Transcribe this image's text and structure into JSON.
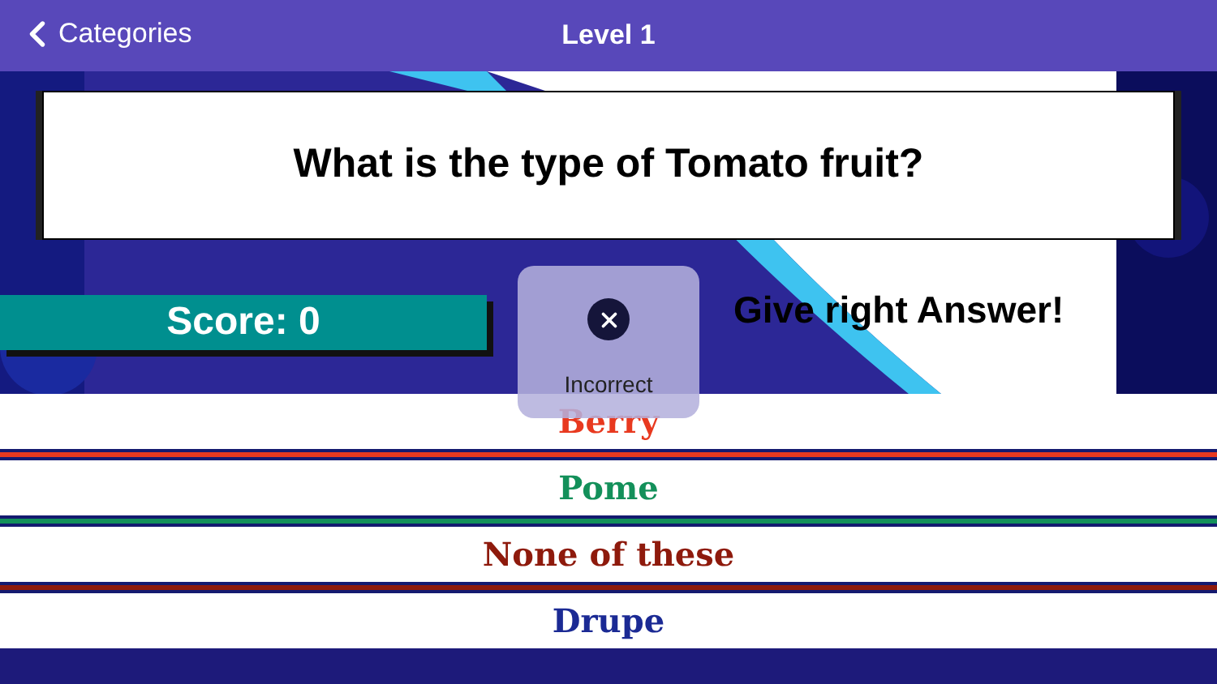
{
  "nav": {
    "back": "Categories",
    "title": "Level 1"
  },
  "question": "What is the type of Tomato fruit?",
  "score": "Score: 0",
  "prompt": "Give right Answer!",
  "hud": {
    "kind": "incorrect",
    "label": "Incorrect"
  },
  "answers": [
    {
      "text": "Berry",
      "color": "#e8391f"
    },
    {
      "text": "Pome",
      "color": "#13905a"
    },
    {
      "text": "None of these",
      "color": "#8e1a0c"
    },
    {
      "text": "Drupe",
      "color": "#1b2a94"
    }
  ]
}
